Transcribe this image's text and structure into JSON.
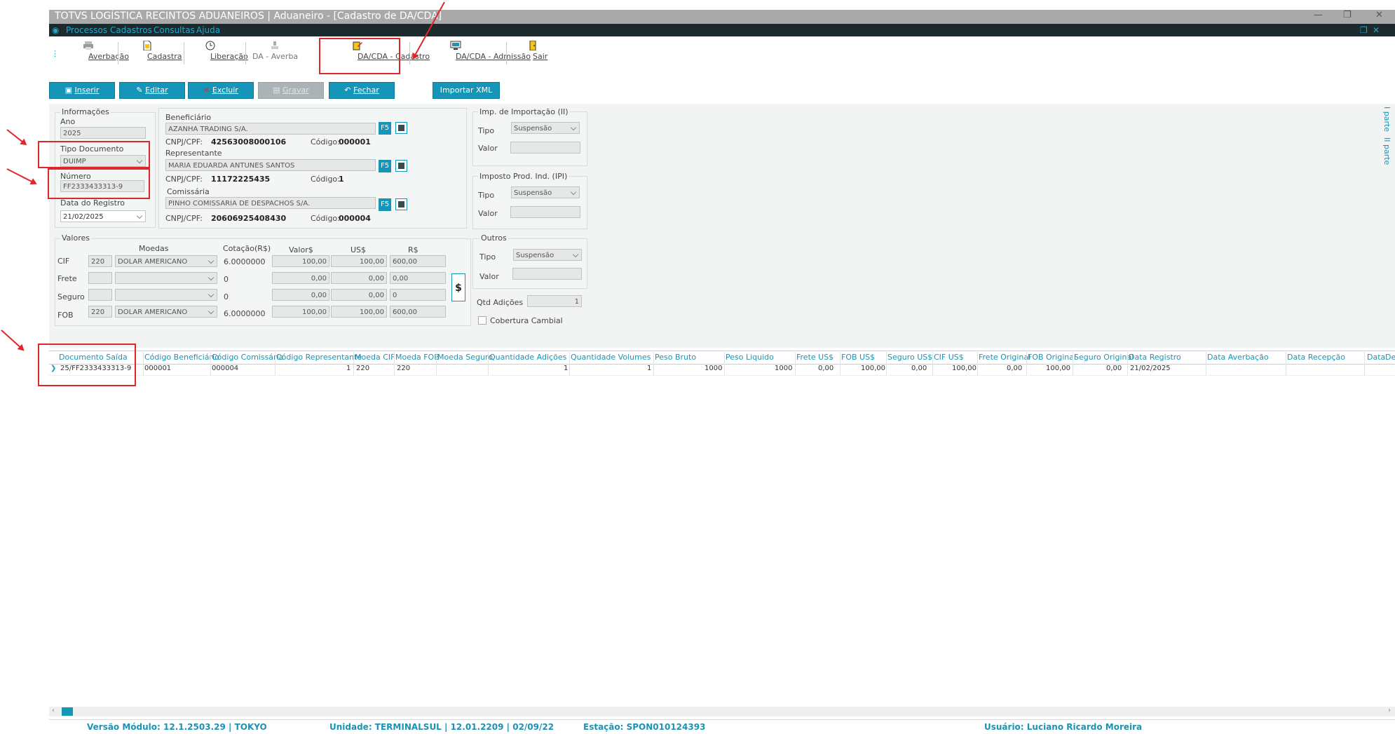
{
  "window": {
    "title": "TOTVS LOGÍSTICA RECINTOS ADUANEIROS | Aduaneiro - [Cadastro de DA/CDA]"
  },
  "menu": [
    "Processos",
    "Cadastros",
    "Consultas",
    "Ajuda"
  ],
  "ribbon": [
    "Averbação",
    "Cadastra",
    "Liberação",
    "DA - Averba",
    "DA/CDA - Cadastro",
    "DA/CDA - Admissão",
    "Sair"
  ],
  "toolbar": {
    "inserir": "Inserir",
    "editar": "Editar",
    "excluir": "Excluir",
    "gravar": "Gravar",
    "fechar": "Fechar",
    "importar": "Importar XML"
  },
  "info": {
    "title": "Informações",
    "ano_label": "Ano",
    "ano": "2025",
    "tipo_label": "Tipo Documento",
    "tipo": "DUIMP",
    "numero_label": "Número",
    "numero": "FF2333433313-9",
    "data_label": "Data do Registro",
    "data": "21/02/2025"
  },
  "partes": {
    "beneficiario_label": "Beneficiário",
    "beneficiario": "AZANHA TRADING S/A.",
    "ben_cnpj_label": "CNPJ/CPF:",
    "ben_cnpj": "42563008000106",
    "ben_cod_label": "Código:",
    "ben_cod": "000001",
    "representante_label": "Representante",
    "representante": "MARIA EDUARDA ANTUNES SANTOS",
    "rep_cnpj_label": "CNPJ/CPF:",
    "rep_cnpj": "11172225435",
    "rep_cod_label": "Código:",
    "rep_cod": "1",
    "comissaria_label": "Comissária",
    "comissaria": "PINHO COMISSARIA DE DESPACHOS S/A.",
    "com_cnpj_label": "CNPJ/CPF:",
    "com_cnpj": "20606925408430",
    "com_cod_label": "Código:",
    "com_cod": "000004",
    "f5": "F5"
  },
  "valores": {
    "title": "Valores",
    "h_moedas": "Moedas",
    "h_cotacao": "Cotação(R$)",
    "h_valor": "Valor$",
    "h_us": "US$",
    "h_rs": "R$",
    "rows": [
      {
        "label": "CIF",
        "code": "220",
        "moeda": "DOLAR AMERICANO",
        "cot": "6.0000000",
        "valor": "100,00",
        "us": "100,00",
        "rs": "600,00"
      },
      {
        "label": "Frete",
        "code": "",
        "moeda": "",
        "cot": "0",
        "valor": "0,00",
        "us": "0,00",
        "rs": "0,00"
      },
      {
        "label": "Seguro",
        "code": "",
        "moeda": "",
        "cot": "0",
        "valor": "0,00",
        "us": "0,00",
        "rs": "0"
      },
      {
        "label": "FOB",
        "code": "220",
        "moeda": "DOLAR AMERICANO",
        "cot": "6.0000000",
        "valor": "100,00",
        "us": "100,00",
        "rs": "600,00"
      }
    ],
    "dollar": "$"
  },
  "impostos": {
    "ii_title": "Imp. de Importação (II)",
    "ipi_title": "Imposto Prod. Ind. (IPI)",
    "outros_title": "Outros",
    "tipo_label": "Tipo",
    "valor_label": "Valor",
    "tipo": "Suspensão",
    "qtd_label": "Qtd Adições",
    "qtd": "1",
    "cobertura": "Cobertura Cambial"
  },
  "sidetabs": [
    "I parte",
    "II parte"
  ],
  "grid": {
    "headers": [
      "Documento Saída",
      "Código Beneficiário",
      "Código Comissária",
      "Código Representante",
      "Moeda CIF",
      "Moeda FOB",
      "Moeda Seguro",
      "Quantidade Adições",
      "Quantidade Volumes",
      "Peso Bruto",
      "Peso Liquido",
      "Frete US$",
      "FOB US$",
      "Seguro US$",
      "CIF US$",
      "Frete Original",
      "FOB Original",
      "Seguro Original",
      "Data Registro",
      "Data Averbação",
      "Data Recepção",
      "Data",
      "De"
    ],
    "row": [
      "25/FF2333433313-9",
      "000001",
      "000004",
      "1",
      "220",
      "220",
      "",
      "1",
      "1",
      "1000",
      "1000",
      "0,00",
      "100,00",
      "0,00",
      "100,00",
      "0,00",
      "100,00",
      "0,00",
      "21/02/2025",
      "",
      "",
      "",
      ""
    ]
  },
  "status": {
    "versao": "Versão Módulo:  12.1.2503.29  |  TOKYO",
    "unidade": "Unidade:  TERMINALSUL | 12.01.2209 | 02/09/22",
    "estacao": "Estação:  SPON010124393",
    "usuario": "Usuário:  Luciano Ricardo Moreira"
  }
}
